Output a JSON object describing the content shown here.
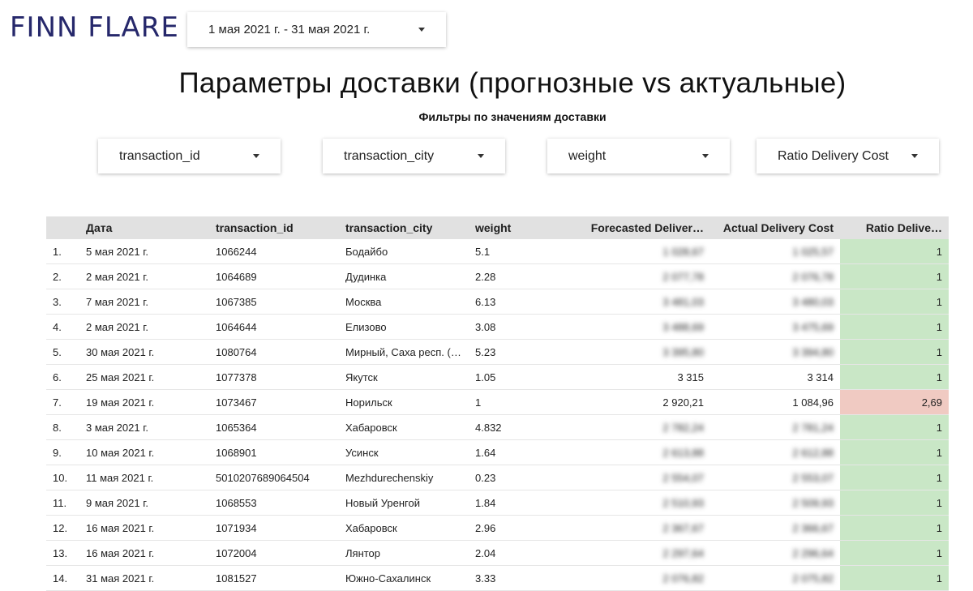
{
  "brand": {
    "logo_text": "FINN FLARE"
  },
  "date_range": {
    "label": "1 мая 2021 г. - 31 мая 2021 г."
  },
  "page": {
    "title": "Параметры доставки (прогнозные vs актуальные)",
    "subtitle": "Фильтры по значениям доставки"
  },
  "filters": [
    {
      "label": "transaction_id"
    },
    {
      "label": "transaction_city"
    },
    {
      "label": "weight"
    },
    {
      "label": "Ratio Delivery Cost"
    }
  ],
  "table": {
    "columns": [
      "",
      "Дата",
      "transaction_id",
      "transaction_city",
      "weight",
      "Forecasted Deliver…",
      "Actual Delivery Cost",
      "Ratio Delive…"
    ],
    "rows": [
      {
        "n": "1.",
        "date": "5 мая 2021 г.",
        "id": "1066244",
        "city": "Бодайбо",
        "weight": "5.1",
        "forecast": "1 028,67",
        "actual": "1 025,57",
        "ratio": "1",
        "status": "ok",
        "blurred": true
      },
      {
        "n": "2.",
        "date": "2 мая 2021 г.",
        "id": "1064689",
        "city": "Дудинка",
        "weight": "2.28",
        "forecast": "2 077,78",
        "actual": "2 076,78",
        "ratio": "1",
        "status": "ok",
        "blurred": true
      },
      {
        "n": "3.",
        "date": "7 мая 2021 г.",
        "id": "1067385",
        "city": "Москва",
        "weight": "6.13",
        "forecast": "3 481,03",
        "actual": "3 480,03",
        "ratio": "1",
        "status": "ok",
        "blurred": true
      },
      {
        "n": "4.",
        "date": "2 мая 2021 г.",
        "id": "1064644",
        "city": "Елизово",
        "weight": "3.08",
        "forecast": "3 488,69",
        "actual": "3 475,69",
        "ratio": "1",
        "status": "ok",
        "blurred": true
      },
      {
        "n": "5.",
        "date": "30 мая 2021 г.",
        "id": "1080764",
        "city": "Мирный, Саха респ. (…",
        "weight": "5.23",
        "forecast": "3 395,80",
        "actual": "3 394,80",
        "ratio": "1",
        "status": "ok",
        "blurred": true
      },
      {
        "n": "6.",
        "date": "25 мая 2021 г.",
        "id": "1077378",
        "city": "Якутск",
        "weight": "1.05",
        "forecast": "3 315",
        "actual": "3 314",
        "ratio": "1",
        "status": "ok",
        "blurred": false
      },
      {
        "n": "7.",
        "date": "19 мая 2021 г.",
        "id": "1073467",
        "city": "Норильск",
        "weight": "1",
        "forecast": "2 920,21",
        "actual": "1 084,96",
        "ratio": "2,69",
        "status": "bad",
        "blurred": false
      },
      {
        "n": "8.",
        "date": "3 мая 2021 г.",
        "id": "1065364",
        "city": "Хабаровск",
        "weight": "4.832",
        "forecast": "2 782,24",
        "actual": "2 781,24",
        "ratio": "1",
        "status": "ok",
        "blurred": true
      },
      {
        "n": "9.",
        "date": "10 мая 2021 г.",
        "id": "1068901",
        "city": "Усинск",
        "weight": "1.64",
        "forecast": "2 613,88",
        "actual": "2 612,88",
        "ratio": "1",
        "status": "ok",
        "blurred": true
      },
      {
        "n": "10.",
        "date": "11 мая 2021 г.",
        "id": "5010207689064504",
        "city": "Mezhdurechenskiy",
        "weight": "0.23",
        "forecast": "2 554,07",
        "actual": "2 553,07",
        "ratio": "1",
        "status": "ok",
        "blurred": true
      },
      {
        "n": "11.",
        "date": "9 мая 2021 г.",
        "id": "1068553",
        "city": "Новый Уренгой",
        "weight": "1.84",
        "forecast": "2 510,93",
        "actual": "2 509,93",
        "ratio": "1",
        "status": "ok",
        "blurred": true
      },
      {
        "n": "12.",
        "date": "16 мая 2021 г.",
        "id": "1071934",
        "city": "Хабаровск",
        "weight": "2.96",
        "forecast": "2 367,67",
        "actual": "2 366,67",
        "ratio": "1",
        "status": "ok",
        "blurred": true
      },
      {
        "n": "13.",
        "date": "16 мая 2021 г.",
        "id": "1072004",
        "city": "Лянтор",
        "weight": "2.04",
        "forecast": "2 297,64",
        "actual": "2 296,64",
        "ratio": "1",
        "status": "ok",
        "blurred": true
      },
      {
        "n": "14.",
        "date": "31 мая 2021 г.",
        "id": "1081527",
        "city": "Южно-Сахалинск",
        "weight": "3.33",
        "forecast": "2 076,82",
        "actual": "2 075,82",
        "ratio": "1",
        "status": "ok",
        "blurred": true
      }
    ]
  },
  "colors": {
    "ratio_ok": "#c9e7c6",
    "ratio_bad": "#f0cac2",
    "logo": "#26286b"
  }
}
